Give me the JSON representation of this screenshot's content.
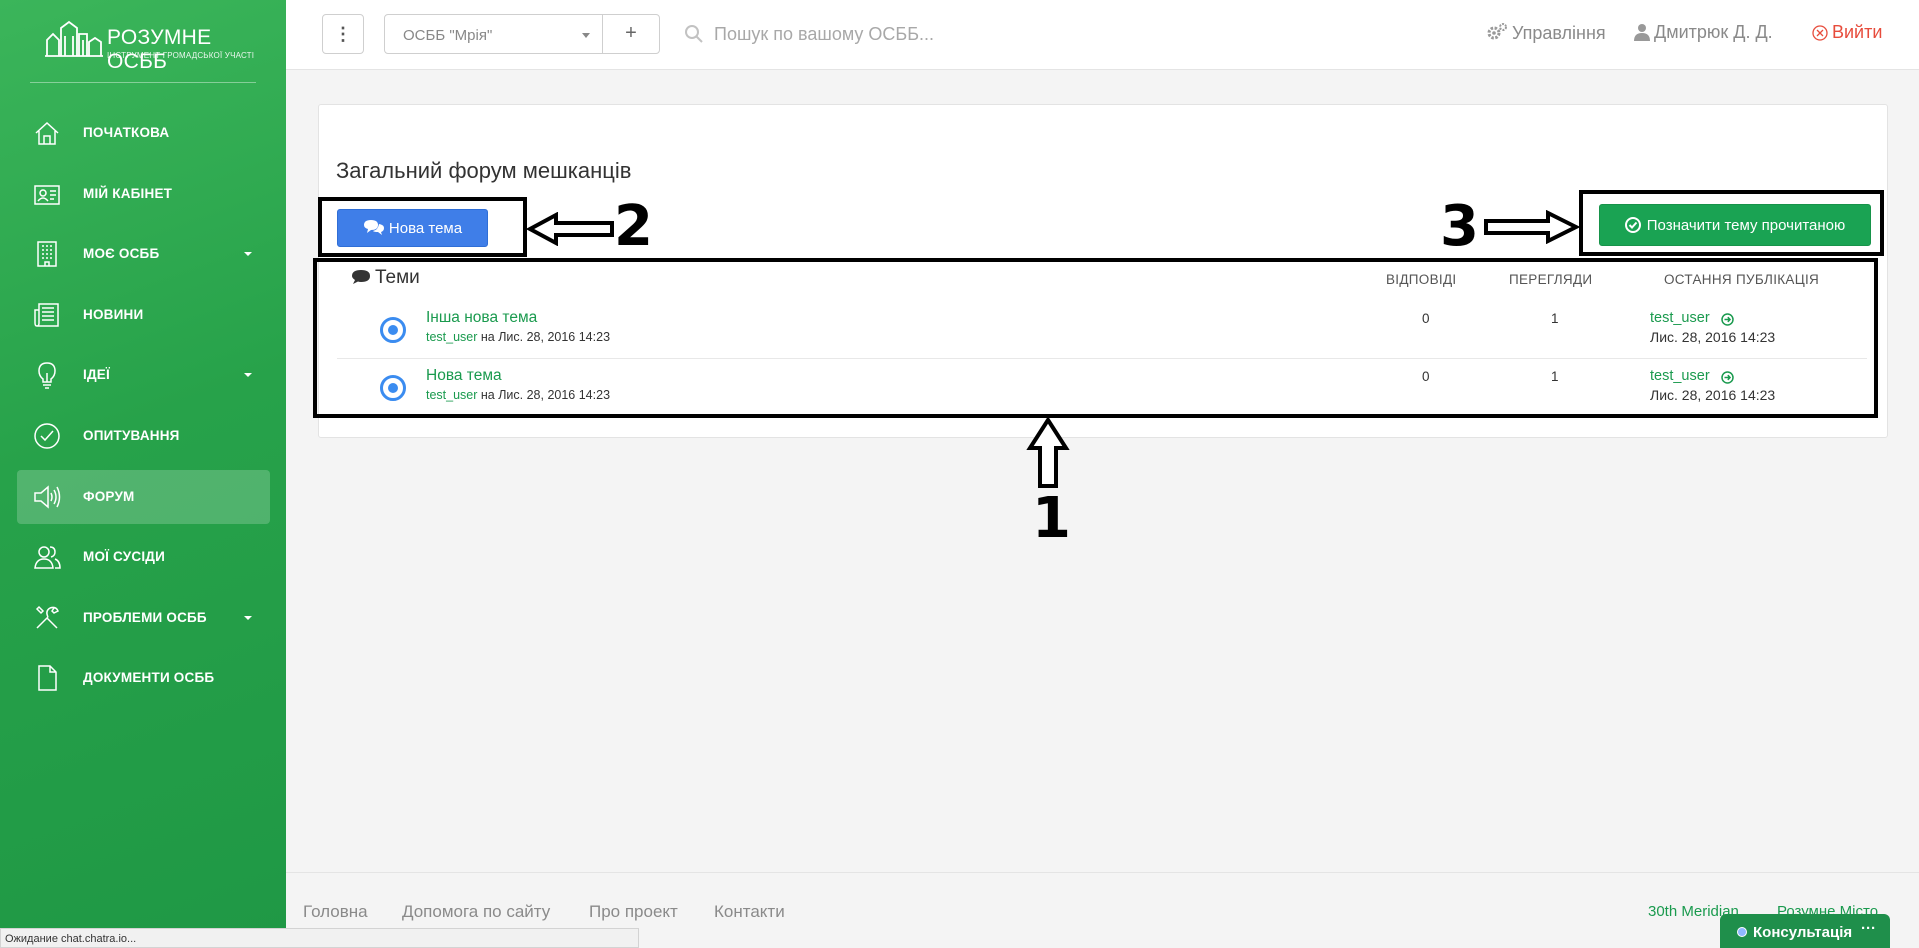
{
  "brand": {
    "title": "РОЗУМНЕ ОСББ",
    "subtitle": "ІНСТРУМЕНТ ГРОМАДСЬКОЇ УЧАСТІ"
  },
  "sidebar": {
    "items": [
      {
        "label": "ПОЧАТКОВА",
        "icon": "home-icon",
        "caret": false,
        "active": false
      },
      {
        "label": "МІЙ КАБІНЕТ",
        "icon": "id-card-icon",
        "caret": false,
        "active": false
      },
      {
        "label": "МОЄ ОСББ",
        "icon": "building-icon",
        "caret": true,
        "active": false
      },
      {
        "label": "НОВИНИ",
        "icon": "newspaper-icon",
        "caret": false,
        "active": false
      },
      {
        "label": "ІДЕЇ",
        "icon": "lightbulb-icon",
        "caret": true,
        "active": false
      },
      {
        "label": "ОПИТУВАННЯ",
        "icon": "check-circle-icon",
        "caret": false,
        "active": false
      },
      {
        "label": "ФОРУМ",
        "icon": "megaphone-icon",
        "caret": false,
        "active": true
      },
      {
        "label": "МОЇ СУСІДИ",
        "icon": "neighbors-icon",
        "caret": false,
        "active": false
      },
      {
        "label": "ПРОБЛЕМИ ОСББ",
        "icon": "tools-icon",
        "caret": true,
        "active": false
      },
      {
        "label": "ДОКУМЕНТИ ОСББ",
        "icon": "document-icon",
        "caret": false,
        "active": false
      }
    ]
  },
  "topbar": {
    "menu_glyph": "⋮",
    "osbb_selected": "ОСББ \"Мрія\"",
    "add_glyph": "+",
    "search_placeholder": "Пошук по вашому ОСББ...",
    "manage_label": "Управління",
    "user_label": "Дмитрюк Д. Д.",
    "logout_label": "Вийти"
  },
  "forum": {
    "title": "Загальний форум мешканців",
    "new_topic_label": "Нова тема",
    "mark_read_label": "Позначити тему прочитаною",
    "topics_label": "Теми",
    "col_replies": "ВІДПОВІДІ",
    "col_views": "ПЕРЕГЛЯДИ",
    "col_last": "ОСТАННЯ ПУБЛІКАЦІЯ",
    "topics": [
      {
        "title": "Інша нова тема",
        "author": "test_user",
        "meta_rest": " на Лис. 28, 2016 14:23",
        "replies": "0",
        "views": "1",
        "last_user": "test_user",
        "last_date": "Лис. 28, 2016 14:23"
      },
      {
        "title": "Нова тема",
        "author": "test_user",
        "meta_rest": " на Лис. 28, 2016 14:23",
        "replies": "0",
        "views": "1",
        "last_user": "test_user",
        "last_date": "Лис. 28, 2016 14:23"
      }
    ]
  },
  "annotations": {
    "one": "1",
    "two": "2",
    "three": "3"
  },
  "footer": {
    "links": [
      "Головна",
      "Допомога по сайту",
      "Про проект",
      "Контакти"
    ],
    "right_links": [
      "30th Meridian",
      "Розумне Місто"
    ]
  },
  "status_text": "Ожидание chat.chatra.io...",
  "chat": {
    "label": "Консультація",
    "more": "···"
  },
  "colors": {
    "sidebar": "#27a24a",
    "primary": "#3f7ee8",
    "success": "#1aa353",
    "link": "#1a9a4e",
    "danger": "#e74c3c"
  }
}
